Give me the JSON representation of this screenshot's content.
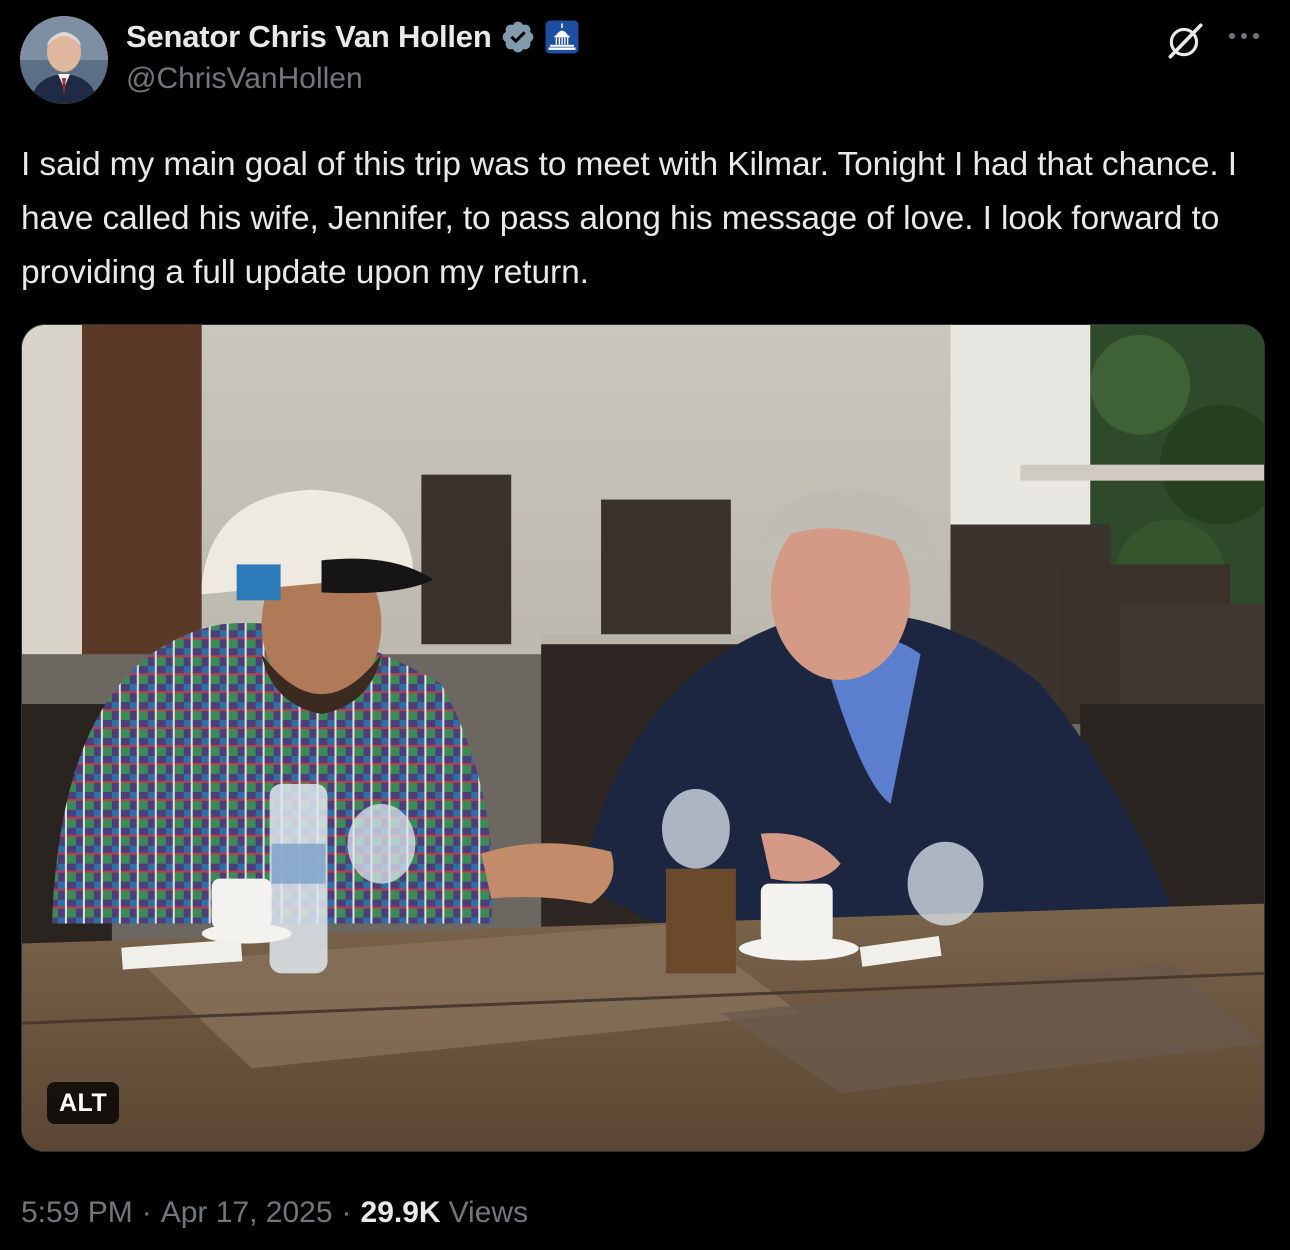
{
  "author": {
    "display_name": "Senator Chris Van Hollen",
    "handle": "@ChrisVanHollen",
    "avatar_icon": "profile-photo",
    "verified_badge_icon": "verified-badge-icon",
    "affiliation_icon": "us-capitol-icon"
  },
  "header_actions": {
    "grok_icon": "grok-icon",
    "more_icon": "more-options-icon"
  },
  "tweet": {
    "text": "I said my main goal of this trip was to meet with Kilmar. Tonight I had that chance. I have called his wife, Jennifer, to pass along his message of love. I look forward to providing a full update upon my return."
  },
  "media": {
    "alt_label": "ALT"
  },
  "meta": {
    "time": "5:59 PM",
    "separator": "·",
    "date": "Apr 17, 2025",
    "views_count": "29.9K",
    "views_label": "Views"
  },
  "colors": {
    "background": "#000000",
    "primary_text": "#e7e9ea",
    "secondary_text": "#71767b",
    "verified_badge": "#829aab",
    "affiliation_badge_bg": "#1d4ea1"
  }
}
